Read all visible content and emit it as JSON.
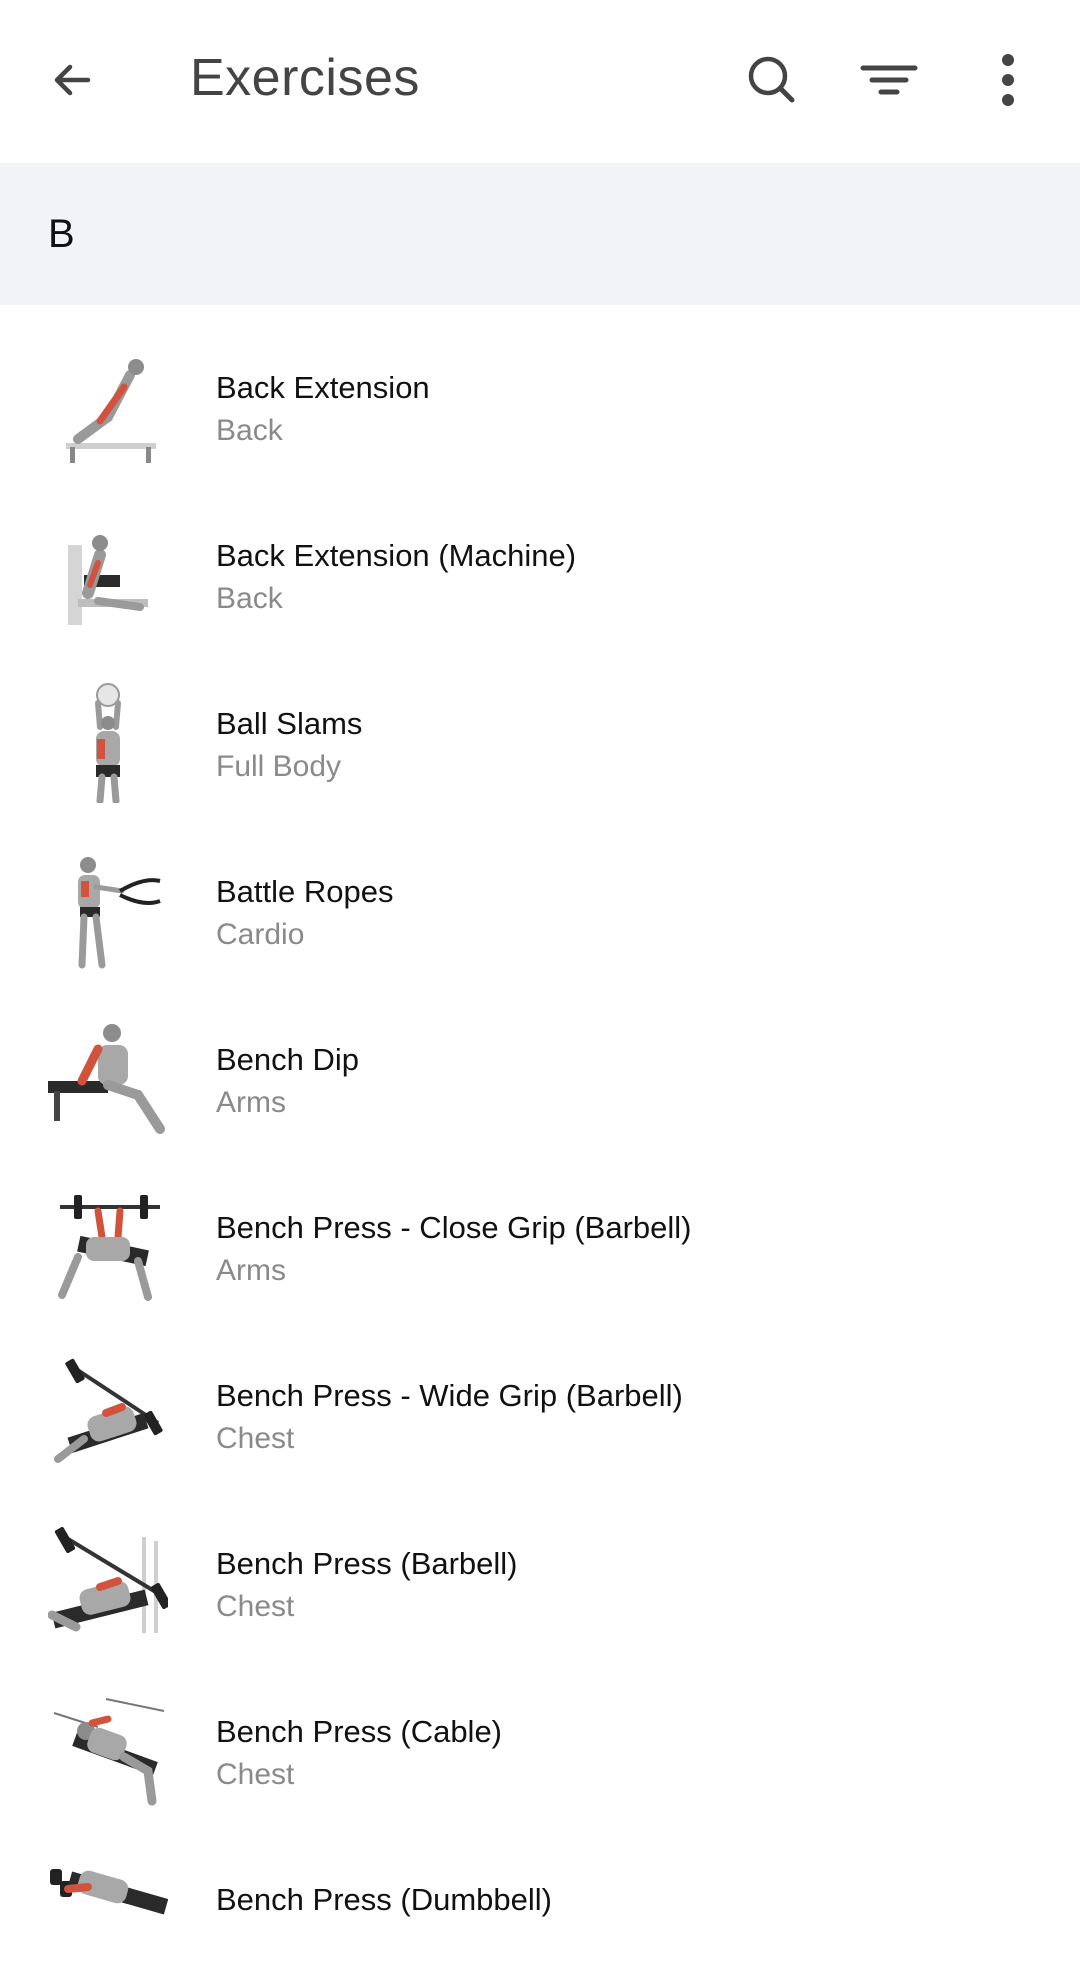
{
  "appbar": {
    "title": "Exercises",
    "back_icon": "arrow-left-icon",
    "search_icon": "search-icon",
    "filter_icon": "filter-icon",
    "more_icon": "more-vert-icon"
  },
  "section": {
    "letter": "B"
  },
  "colors": {
    "section_bg": "#f2f3f6",
    "muscle_highlight": "#d2533d",
    "category_text": "#8a8a8a"
  },
  "exercises": [
    {
      "name": "Back Extension",
      "category": "Back"
    },
    {
      "name": "Back Extension (Machine)",
      "category": "Back"
    },
    {
      "name": "Ball Slams",
      "category": "Full Body"
    },
    {
      "name": "Battle Ropes",
      "category": "Cardio"
    },
    {
      "name": "Bench Dip",
      "category": "Arms"
    },
    {
      "name": "Bench Press - Close Grip (Barbell)",
      "category": "Arms"
    },
    {
      "name": "Bench Press - Wide Grip (Barbell)",
      "category": "Chest"
    },
    {
      "name": "Bench Press (Barbell)",
      "category": "Chest"
    },
    {
      "name": "Bench Press (Cable)",
      "category": "Chest"
    },
    {
      "name": "Bench Press (Dumbbell)",
      "category": ""
    }
  ]
}
